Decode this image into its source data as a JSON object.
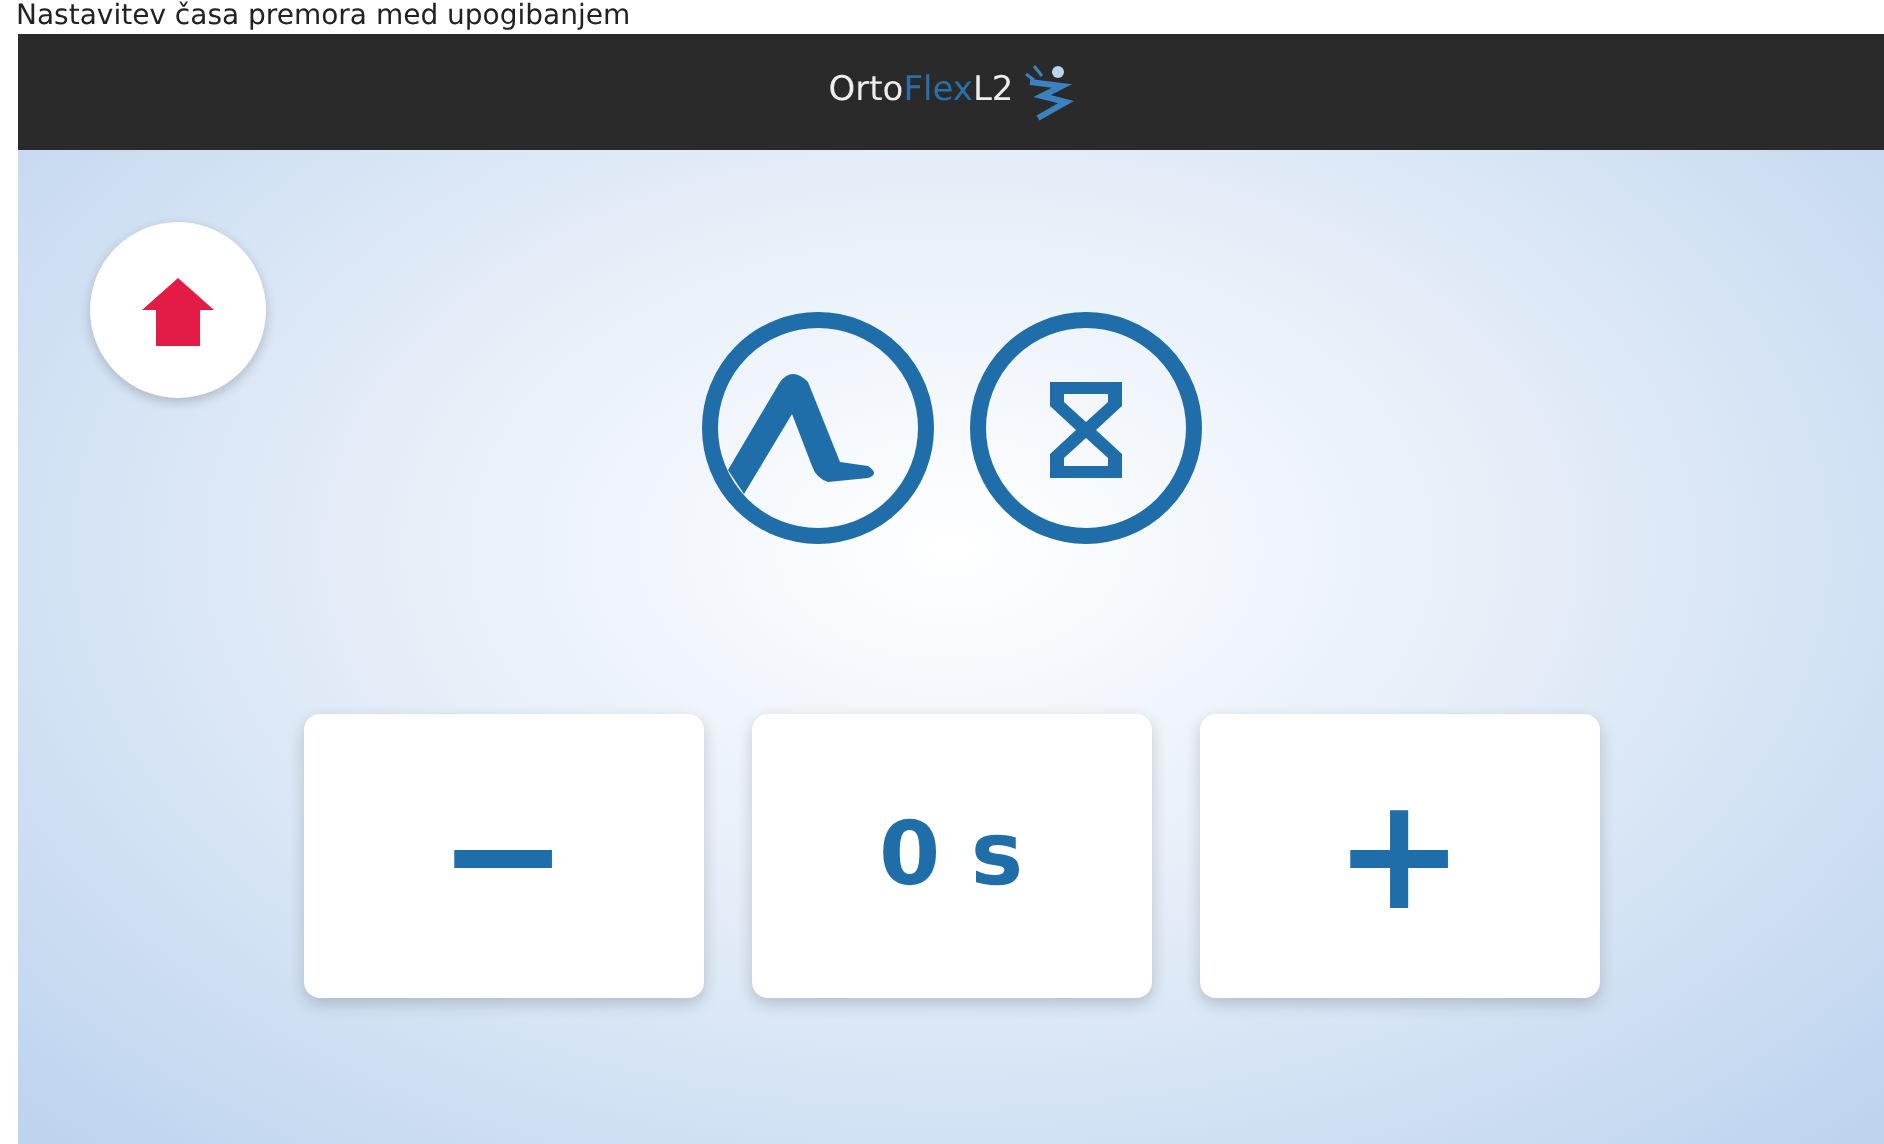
{
  "caption": "Nastavitev časa premora med upogibanjem",
  "logo": {
    "parts": [
      {
        "text": "Orto",
        "accent": false
      },
      {
        "text": "Flex",
        "accent": true
      },
      {
        "text": "L2",
        "accent": false
      }
    ]
  },
  "controls": [
    {
      "kind": "button",
      "label": "−"
    },
    {
      "kind": "display",
      "label": "0 s"
    },
    {
      "kind": "button",
      "label": "+"
    }
  ]
}
